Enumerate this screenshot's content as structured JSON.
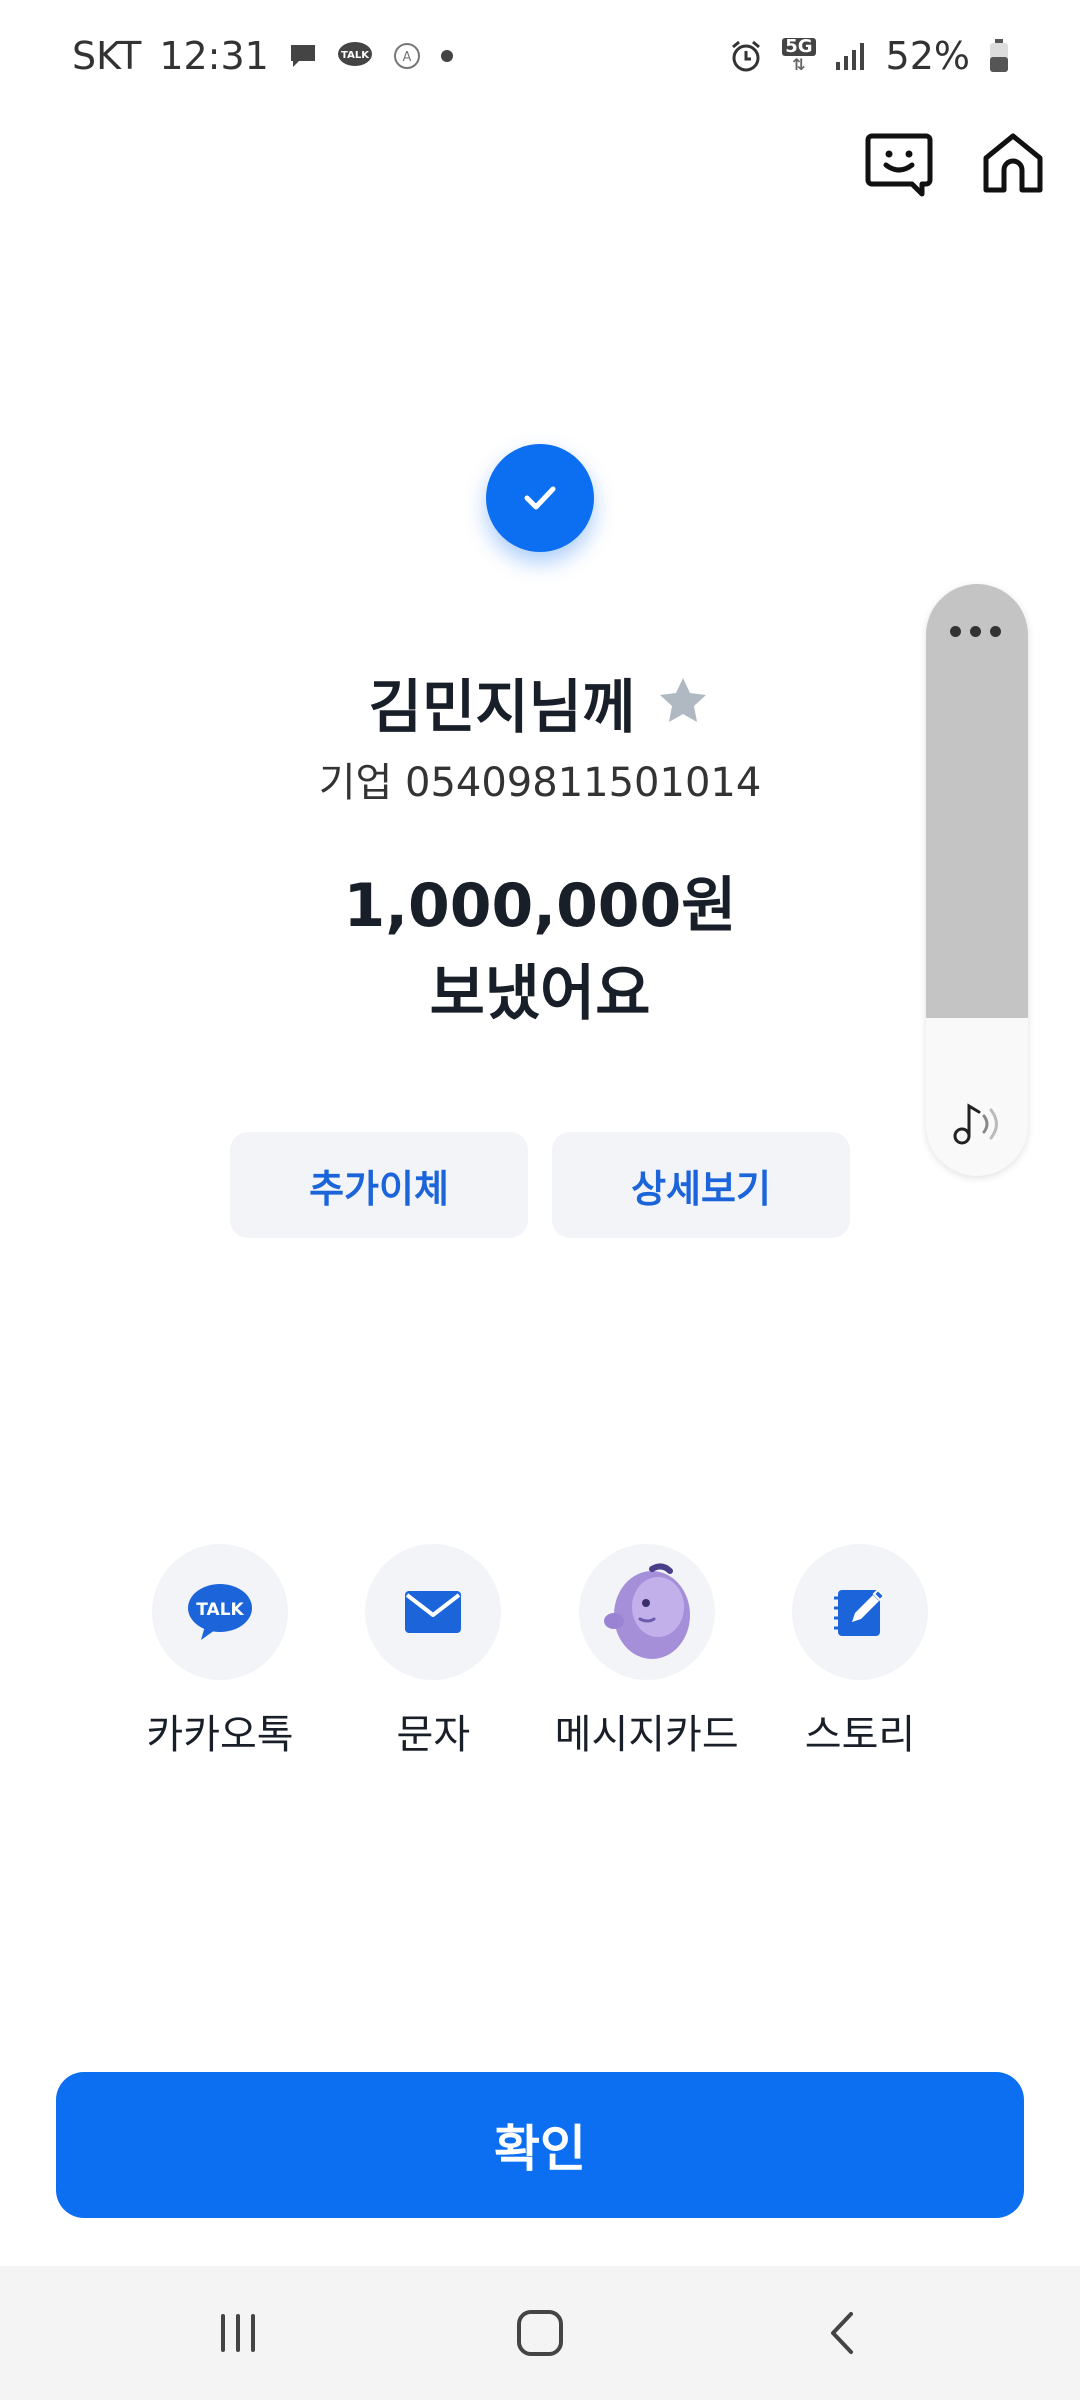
{
  "status_bar": {
    "carrier": "SKT",
    "time": "12:31",
    "network": "5G",
    "battery": "52%"
  },
  "header": {
    "icons": [
      "chat-smile-icon",
      "home-icon"
    ]
  },
  "transfer": {
    "recipient_name": "김민지님께",
    "account": "기업 05409811501014",
    "amount_line1": "1,000,000원",
    "amount_line2": "보냈어요"
  },
  "actions": {
    "additional_transfer": "추가이체",
    "details": "상세보기"
  },
  "share": {
    "items": [
      {
        "label": "카카오톡",
        "icon": "kakaotalk-icon",
        "badge": "TALK"
      },
      {
        "label": "문자",
        "icon": "mail-icon"
      },
      {
        "label": "메시지카드",
        "icon": "character-icon"
      },
      {
        "label": "스토리",
        "icon": "edit-note-icon"
      }
    ]
  },
  "confirm_label": "확인",
  "colors": {
    "accent": "#0c6ef0",
    "secondary_text": "#1b64da",
    "button_bg": "#f2f4f8"
  }
}
